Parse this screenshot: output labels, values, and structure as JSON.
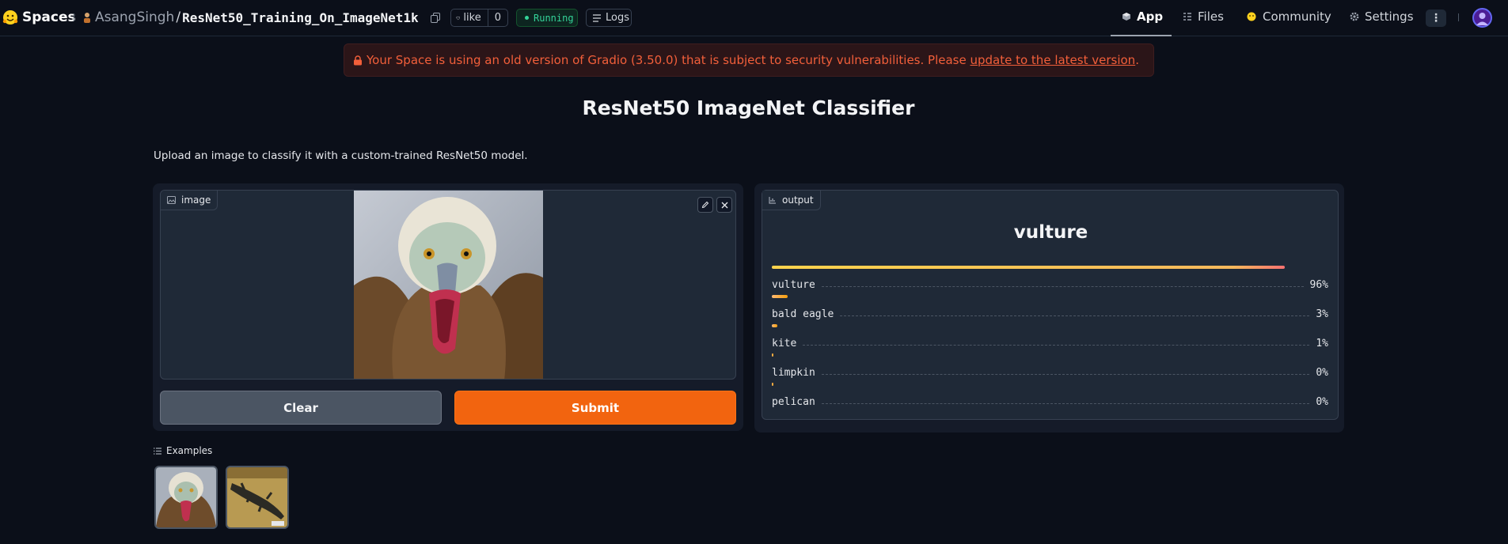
{
  "header": {
    "brand": "Spaces",
    "owner": "AsangSingh",
    "separator": "/",
    "repo": "ResNet50_Training_On_ImageNet1k",
    "like_label": "like",
    "like_count": "0",
    "status": "Running",
    "logs_label": "Logs",
    "nav": [
      {
        "label": "App",
        "icon": "cube-icon",
        "active": true
      },
      {
        "label": "Files",
        "icon": "files-icon",
        "active": false
      },
      {
        "label": "Community",
        "icon": "community-icon",
        "active": false
      },
      {
        "label": "Settings",
        "icon": "gear-icon",
        "active": false
      }
    ],
    "more_label": "⋮"
  },
  "warning": {
    "text": "Your Space is using an old version of Gradio (3.50.0) that is subject to security vulnerabilities. Please ",
    "link": "update to the latest version",
    "suffix": "."
  },
  "main": {
    "title": "ResNet50 ImageNet Classifier",
    "description": "Upload an image to classify it with a custom-trained ResNet50 model."
  },
  "input": {
    "label": "image",
    "clear_label": "Clear",
    "submit_label": "Submit"
  },
  "output": {
    "label": "output",
    "top_label": "vulture",
    "confidences": [
      {
        "label": "vulture",
        "value": 0.96,
        "text": "96%"
      },
      {
        "label": "bald eagle",
        "value": 0.03,
        "text": "3%"
      },
      {
        "label": "kite",
        "value": 0.01,
        "text": "1%"
      },
      {
        "label": "limpkin",
        "value": 0.0,
        "text": "0%"
      },
      {
        "label": "pelican",
        "value": 0.0,
        "text": "0%"
      }
    ]
  },
  "examples": {
    "title": "Examples"
  },
  "colors": {
    "accent": "#f2640f",
    "warning": "#f25f3a",
    "running": "#34d399",
    "background": "#0b0f19"
  }
}
